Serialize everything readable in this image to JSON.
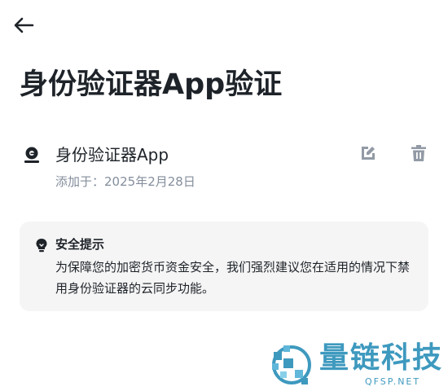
{
  "header": {
    "back_icon": "arrow-left-icon",
    "title": "身份验证器App验证"
  },
  "authenticator": {
    "icon": "authenticator-icon",
    "name": "身份验证器App",
    "added_label": "添加于：",
    "added_date": "2025年2月28日",
    "edit_icon": "edit-icon",
    "delete_icon": "trash-icon"
  },
  "notice": {
    "icon": "lightbulb-icon",
    "title": "安全提示",
    "body": "为保障您的加密货币资金安全，我们强烈建议您在适用的情况下禁用身份验证器的云同步功能。"
  },
  "watermark": {
    "text": "量链科技",
    "sub": "QFSP.NET"
  },
  "colors": {
    "text_primary": "#1e2329",
    "text_secondary": "#848e9c",
    "icon_gray": "#929aa5",
    "card_bg": "#f5f5f5",
    "watermark": "#2a8fb8"
  }
}
